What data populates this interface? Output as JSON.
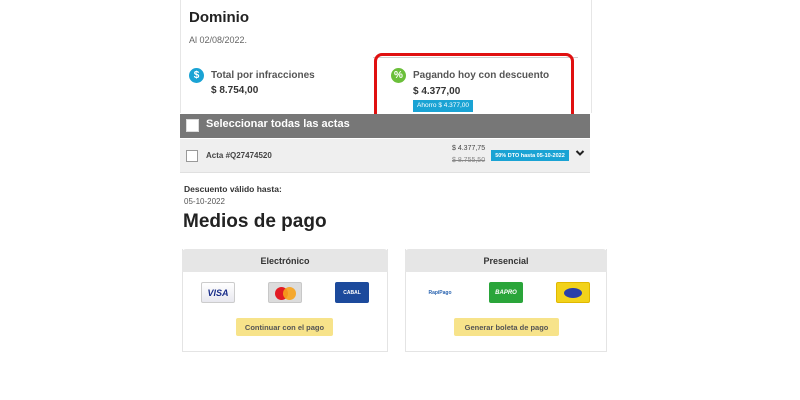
{
  "header": {
    "title": "Dominio",
    "date": "Al 02/08/2022."
  },
  "summary": {
    "total_label": "Total por infracciones",
    "total_value": "$ 8.754,00",
    "pay_label": "Pagando hoy con descuento",
    "pay_value": "$ 4.377,00",
    "savings_badge": "Ahorro $ 4.377,00",
    "dollar_glyph": "$",
    "percent_glyph": "%"
  },
  "selection": {
    "select_all_label": "Seleccionar todas las actas"
  },
  "acts": [
    {
      "label": "Acta #Q27474520",
      "price": "$ 4.377,75",
      "old_price": "$ 8.755,50",
      "badge": "50% DTO hasta 05-10-2022"
    }
  ],
  "discount": {
    "label": "Descuento válido hasta:",
    "date": "05-10-2022"
  },
  "payment": {
    "title": "Medios de pago",
    "electronic": {
      "header": "Electrónico",
      "visa_text": "VISA",
      "cabal_text": "CABAL",
      "button": "Continuar con el pago"
    },
    "in_person": {
      "header": "Presencial",
      "rapipago_text": "RapiPago",
      "bapro_text": "BAPRO",
      "button": "Generar boleta de pago"
    }
  },
  "colors": {
    "accent_blue": "#1aa3d4",
    "accent_green": "#6bbf3a",
    "highlight_red": "#e01010",
    "button_yellow": "#f7e38a"
  }
}
